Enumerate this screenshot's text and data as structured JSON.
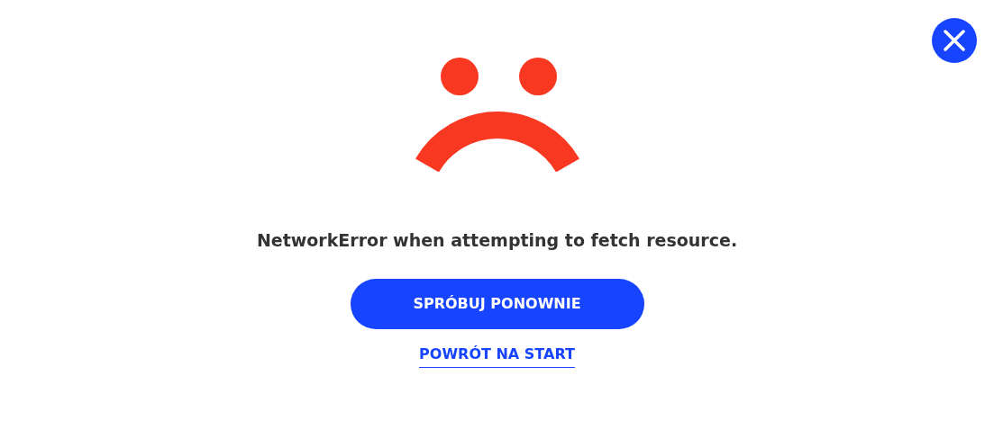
{
  "message": "NetworkError when attempting to fetch resource.",
  "retry_button": "SPRÓBUJ PONOWNIE",
  "home_link": "POWRÓT NA START"
}
